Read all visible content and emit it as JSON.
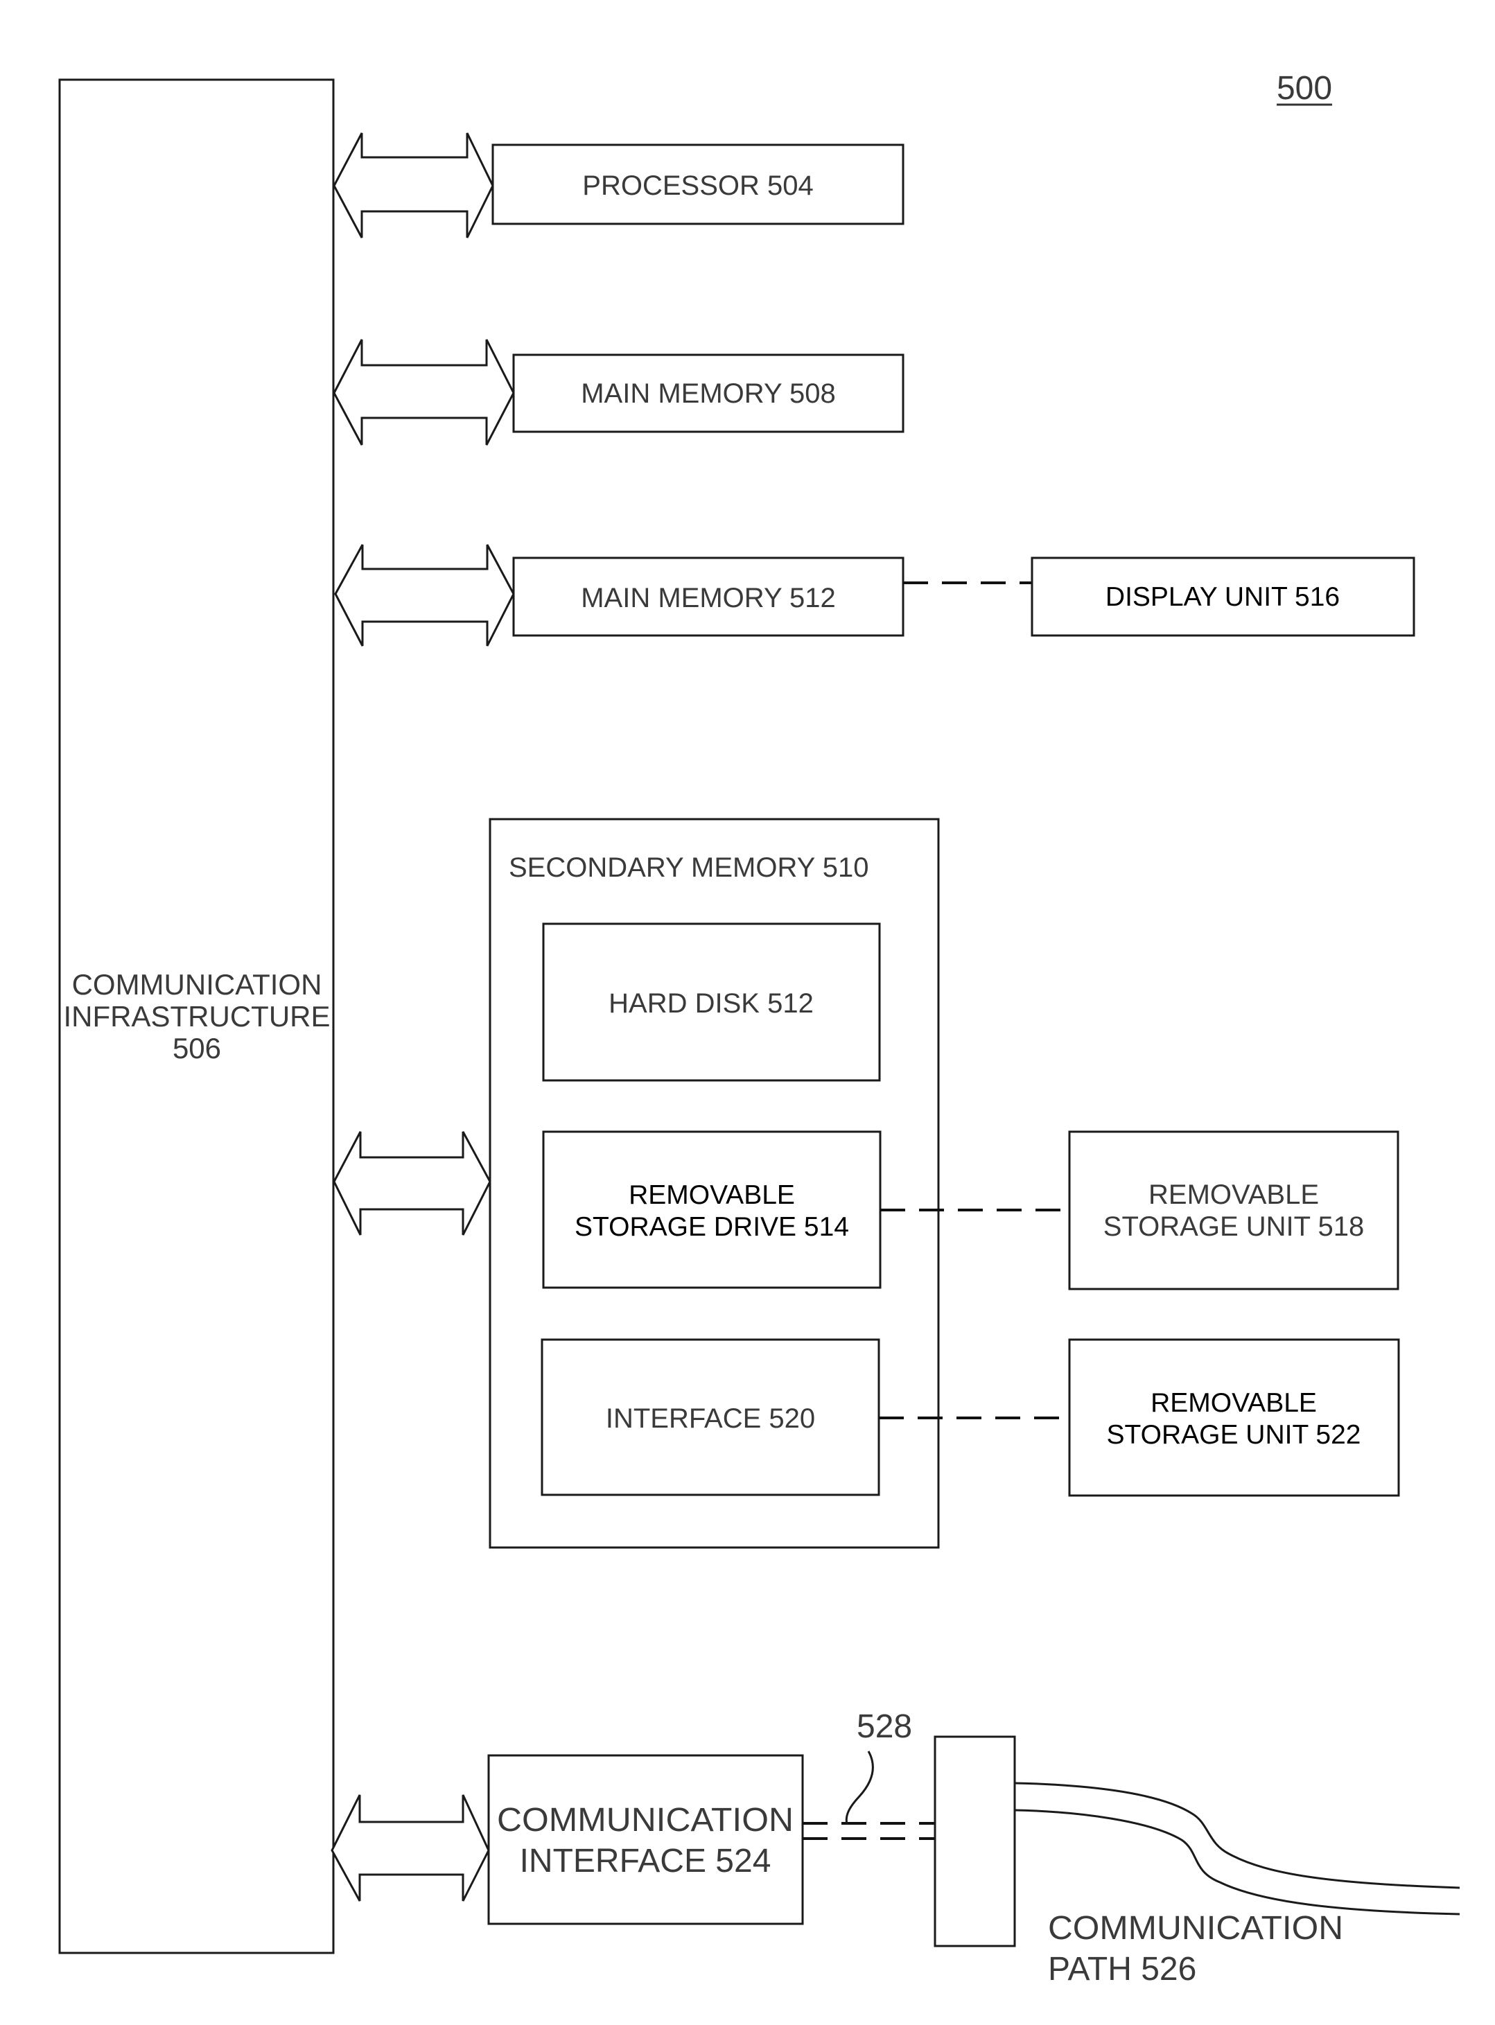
{
  "figure": {
    "reference_number": "500",
    "communication_infrastructure": {
      "lines": [
        "COMMUNICATION",
        "INFRASTRUCTURE",
        "506"
      ]
    },
    "processor": {
      "label": "PROCESSOR 504"
    },
    "main_memory_508": {
      "label": "MAIN MEMORY 508"
    },
    "main_memory_512": {
      "label": "MAIN MEMORY 512"
    },
    "display_unit": {
      "label": "DISPLAY UNIT 516"
    },
    "secondary_memory": {
      "label": "SECONDARY MEMORY 510",
      "hard_disk": {
        "label": "HARD DISK 512"
      },
      "removable_storage_drive": {
        "lines": [
          "REMOVABLE",
          "STORAGE DRIVE 514"
        ]
      },
      "interface": {
        "label": "INTERFACE 520"
      }
    },
    "removable_storage_unit_518": {
      "lines": [
        "REMOVABLE",
        "STORAGE UNIT 518"
      ]
    },
    "removable_storage_unit_522": {
      "lines": [
        "REMOVABLE",
        "STORAGE UNIT 522"
      ]
    },
    "communication_interface": {
      "lines": [
        "COMMUNICATION",
        "INTERFACE 524"
      ]
    },
    "signal_label": "528",
    "communication_path": {
      "lines": [
        "COMMUNICATION",
        "PATH 526"
      ]
    }
  }
}
